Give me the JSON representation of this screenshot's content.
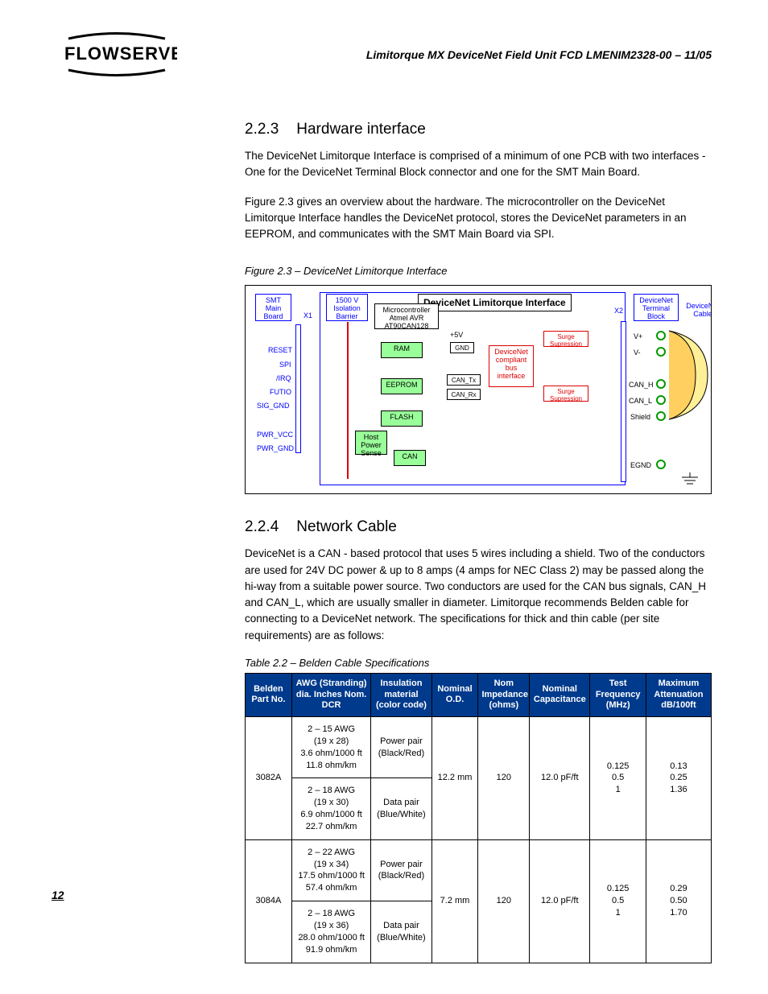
{
  "header": {
    "doc_title": "Limitorque MX DeviceNet Field Unit   FCD LMENIM2328-00 – 11/05"
  },
  "page_number": "12",
  "section_223": {
    "num": "2.2.3",
    "title": "Hardware interface",
    "p1": "The DeviceNet Limitorque Interface is comprised of a minimum of one PCB with two interfaces - One for the DeviceNet Terminal Block connector and one for the SMT Main Board.",
    "p2": "Figure 2.3 gives an overview about the hardware. The microcontroller on the DeviceNet Limitorque Interface handles the DeviceNet protocol, stores the DeviceNet parameters in an EEPROM, and communicates with the SMT Main Board via SPI."
  },
  "figure": {
    "caption": "Figure 2.3 – DeviceNet Limitorque Interface",
    "labels": {
      "smt": "SMT Main Board",
      "reset": "RESET",
      "spi": "SPI",
      "irq": "/IRQ",
      "futio": "FUTIO",
      "sig_gnd": "SIG_GND",
      "pwr_vcc": "PWR_VCC",
      "pwr_gnd": "PWR_GND",
      "x1": "X1",
      "iso": "1500 V Isolation Barrier",
      "micro": "Microcontroller Atmel AVR AT90CAN128",
      "ram": "RAM",
      "eeprom": "EEPROM",
      "flash": "FLASH",
      "host": "Host Power Sense",
      "can": "CAN",
      "title": "DeviceNet Limitorque Interface",
      "p5v": "+5V",
      "gnd": "GND",
      "can_tx": "CAN_Tx",
      "can_rx": "CAN_Rx",
      "surge1": "Surge Supression",
      "surge2": "Surge Supression",
      "bus": "DeviceNet compliant bus interface",
      "x2": "X2",
      "term_block": "DeviceNet Terminal Block",
      "cable": "DeviceNet Cable",
      "vp": "V+",
      "vm": "V-",
      "can_h": "CAN_H",
      "can_l": "CAN_L",
      "shield": "Shield",
      "egnd": "EGND"
    }
  },
  "section_224": {
    "num": "2.2.4",
    "title": "Network Cable",
    "p1": "DeviceNet is a CAN - based protocol that uses 5 wires including a shield. Two of the conductors are used for 24V DC power & up to 8 amps (4 amps for NEC Class 2) may be passed along the hi-way from a suitable power source. Two conductors are used for the CAN bus signals, CAN_H and CAN_L, which are usually smaller in diameter. Limitorque recommends Belden cable for connecting to a DeviceNet network. The specifications for thick and thin cable (per site requirements) are as follows:"
  },
  "table": {
    "caption": "Table 2.2 – Belden Cable Specifications",
    "headers": {
      "c0": "Belden Part No.",
      "c1": "AWG (Stranding) dia. Inches Nom. DCR",
      "c2": "Insulation material (color code)",
      "c3": "Nominal O.D.",
      "c4": "Nom Impedance (ohms)",
      "c5": "Nominal Capacitance",
      "c6": "Test Frequency (MHz)",
      "c7": "Maximum Attenuation dB/100ft"
    },
    "rows": [
      {
        "part_no": "3082A",
        "awg_a": "2 – 15 AWG\n(19 x 28)\n3.6 ohm/1000 ft\n11.8 ohm/km",
        "ins_a": "Power pair\n(Black/Red)",
        "awg_b": "2 – 18 AWG\n(19 x 30)\n6.9 ohm/1000 ft\n22.7 ohm/km",
        "ins_b": "Data pair\n(Blue/White)",
        "od": "12.2 mm",
        "imp": "120",
        "cap": "12.0 pF/ft",
        "freq": "0.125\n0.5\n1",
        "att": "0.13\n0.25\n1.36"
      },
      {
        "part_no": "3084A",
        "awg_a": "2 – 22 AWG\n(19 x 34)\n17.5 ohm/1000 ft\n57.4 ohm/km",
        "ins_a": "Power pair\n(Black/Red)",
        "awg_b": "2 – 18 AWG\n(19 x 36)\n28.0 ohm/1000 ft\n91.9 ohm/km",
        "ins_b": "Data pair\n(Blue/White)",
        "od": "7.2 mm",
        "imp": "120",
        "cap": "12.0 pF/ft",
        "freq": "0.125\n0.5\n1",
        "att": "0.29\n0.50\n1.70"
      }
    ]
  }
}
